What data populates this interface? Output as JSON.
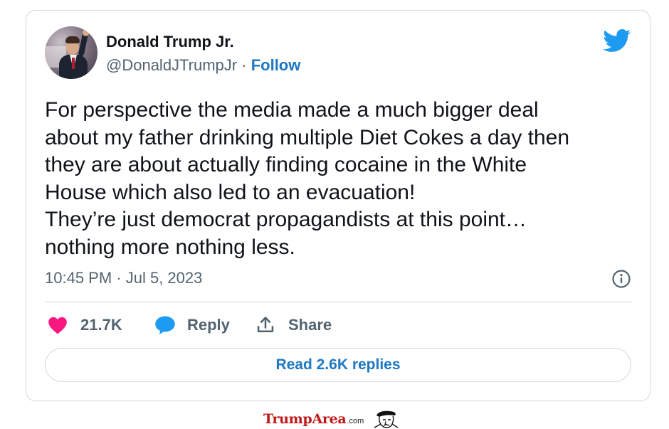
{
  "tweet": {
    "author_name": "Donald Trump Jr.",
    "author_handle": "@DonaldJTrumpJr",
    "separator": "·",
    "follow_label": "Follow",
    "text_lines": [
      "For perspective the media made a much bigger deal",
      "about my father drinking multiple Diet Cokes a day then",
      "they are about actually finding cocaine in the White",
      "House which also led to an evacuation!",
      "They’re just democrat propagandists at this point…",
      "nothing more nothing less."
    ],
    "timestamp": "10:45 PM · Jul 5, 2023",
    "likes_count": "21.7K",
    "reply_label": "Reply",
    "share_label": "Share",
    "read_replies_label": "Read 2.6K replies"
  },
  "watermark": {
    "brand": "TrumpArea",
    "suffix": ".com"
  },
  "icons": {
    "platform": "twitter-bird-icon",
    "info": "info-icon",
    "like": "heart-icon",
    "reply": "speech-bubble-icon",
    "share": "share-upload-icon"
  },
  "colors": {
    "text_primary": "#0f1419",
    "text_secondary": "#536471",
    "link_blue": "#1d77c2",
    "twitter_blue": "#1d9bf0",
    "like_pink": "#f91880",
    "border": "#cfd9de",
    "watermark_red": "#c01717"
  }
}
